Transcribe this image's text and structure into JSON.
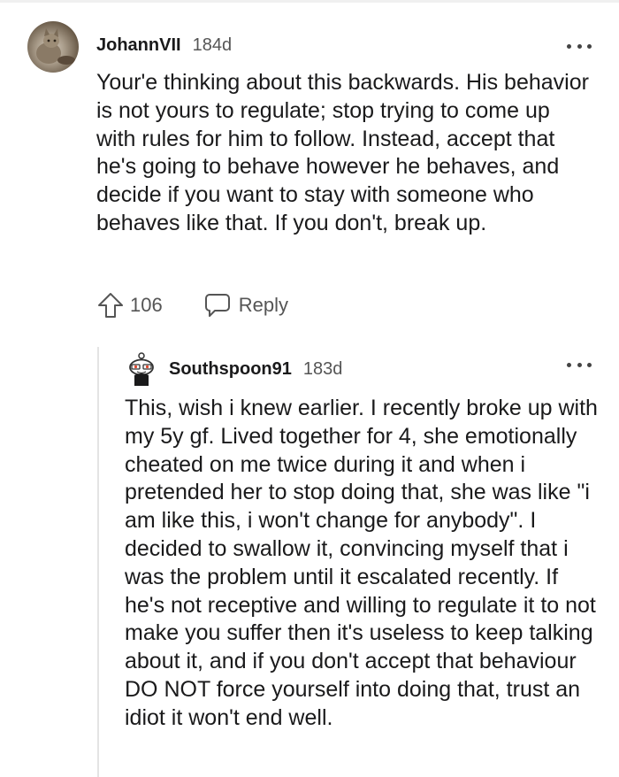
{
  "comment": {
    "username": "JohannVII",
    "age": "184d",
    "body": "Your'e thinking about this backwards. His behavior is not yours to regulate; stop trying to come up with rules for him to follow. Instead, accept that he's going to behave however he behaves, and decide if you want to stay with someone who behaves like that. If you don't, break up.",
    "votes": "106",
    "reply_label": "Reply"
  },
  "reply": {
    "username": "Southspoon91",
    "age": "183d",
    "body": "This, wish i knew earlier. I recently broke up with my 5y gf. Lived together for 4, she emotionally cheated on me twice during it and when i pretended her to stop doing that, she was like \"i am like this, i won't change for anybody\". I decided to swallow it, convincing myself that i was the problem until it escalated recently. If he's not receptive and willing to regulate it to not make you suffer then it's useless to keep talking about it, and if you don't accept that behaviour DO NOT force yourself into doing that, trust an idiot it won't end well."
  },
  "icons": {
    "upvote": "arrow-up-outline-icon",
    "reply": "speech-bubble-icon",
    "more": "ellipsis-icon",
    "avatar_reply": "snoo-avatar-icon"
  },
  "colors": {
    "text": "#1a1a1b",
    "meta": "#555555",
    "thread_line": "#e4e4e4"
  }
}
